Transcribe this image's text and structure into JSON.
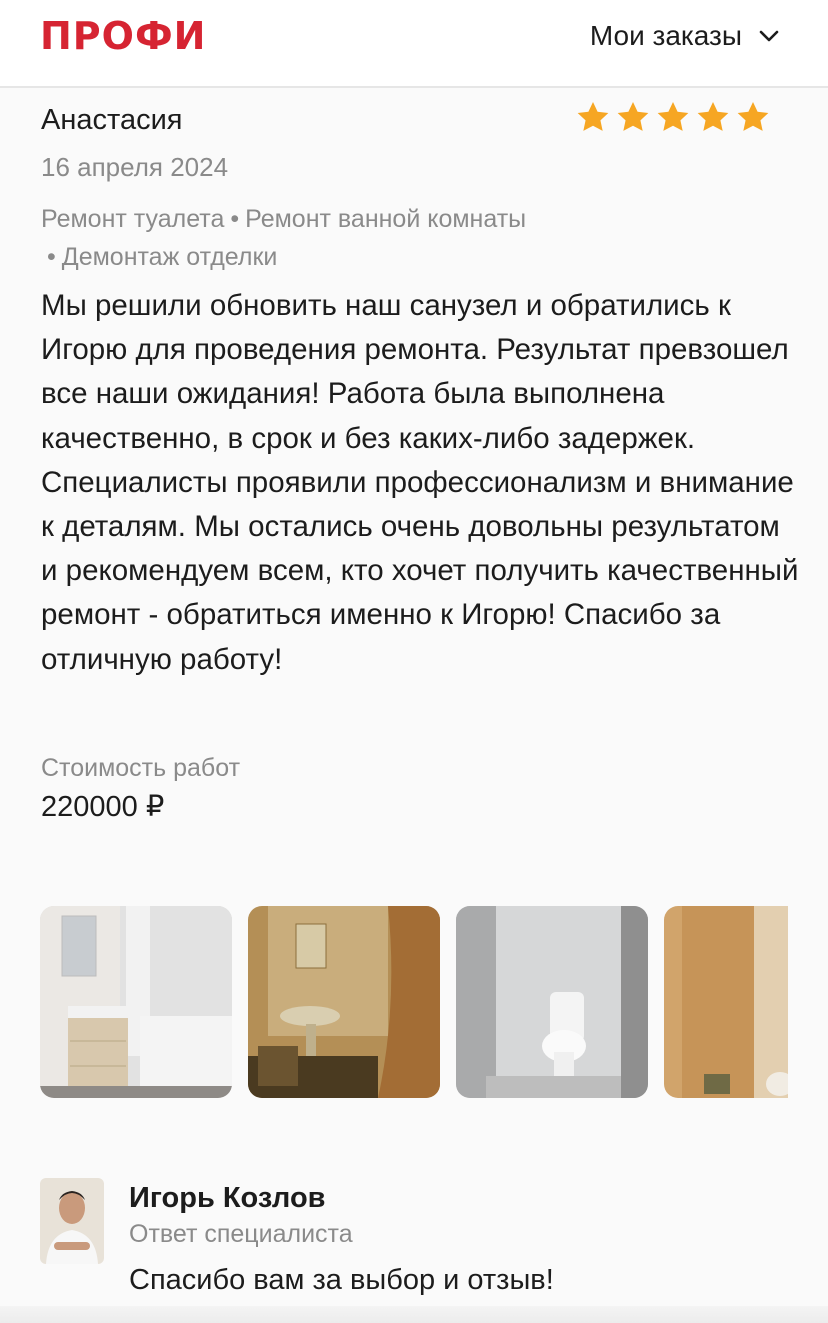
{
  "header": {
    "logo": "ПРОФИ",
    "orders_label": "Мои заказы",
    "orders_icon": "chevron-down-icon"
  },
  "review": {
    "author": "Анастасия",
    "rating": 5,
    "rating_max": 5,
    "date": "16 апреля 2024",
    "services": [
      "Ремонт туалета",
      "Ремонт ванной комнаты",
      "Демонтаж отделки"
    ],
    "text": "Мы решили обновить наш санузел и обратились к Игорю для проведения ремонта. Результат превзошел все наши ожидания! Работа была выполнена качественно, в срок и без каких-либо задержек. Специалисты проявили профессионализм и внимание к деталям. Мы остались очень довольны результатом и рекомендуем всем, кто хочет получить качественный ремонт - обратиться именно к Игорю! Спасибо за отличную работу!",
    "cost_label": "Стоимость работ",
    "cost_value": "220000 ₽",
    "photo_count_visible": 4
  },
  "reply": {
    "name": "Игорь Козлов",
    "role": "Ответ специалиста",
    "text": "Спасибо вам за выбор и отзыв!"
  },
  "colors": {
    "brand": "#d62432",
    "star": "#f6a623",
    "muted_text": "#8a8a8a",
    "text": "#1c1c1c",
    "background": "#fafafa"
  }
}
